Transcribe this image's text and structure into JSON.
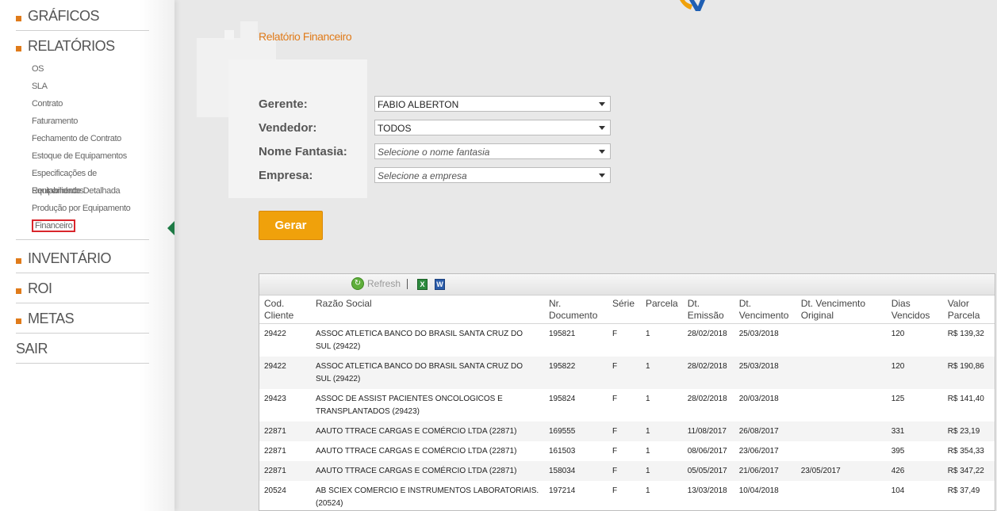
{
  "sidebar": {
    "graficos": "GRÁFICOS",
    "relatorios": "RELATÓRIOS",
    "relatorios_items": [
      "OS",
      "SLA",
      "Contrato",
      "Faturamento",
      "Fechamento de Contrato",
      "Estoque de Equipamentos",
      "Especificações de Equipamentos",
      "Rentabilidade Detalhada",
      "Produção por Equipamento",
      "Financeiro"
    ],
    "active_item": "Financeiro",
    "inventario": "INVENTÁRIO",
    "roi": "ROI",
    "metas": "METAS",
    "sair": "SAIR"
  },
  "page": {
    "title": "Relatório Financeiro"
  },
  "form": {
    "gerente_label": "Gerente:",
    "gerente_value": "FABIO ALBERTON",
    "vendedor_label": "Vendedor:",
    "vendedor_value": "TODOS",
    "fantasia_label": "Nome Fantasia:",
    "fantasia_placeholder": "Selecione o nome fantasia",
    "empresa_label": "Empresa:",
    "empresa_placeholder": "Selecione a empresa",
    "gerar_label": "Gerar"
  },
  "grid": {
    "toolbar": {
      "refresh_label": "Refresh",
      "excel_icon": "excel-export-icon",
      "word_icon": "word-export-icon"
    },
    "headers": {
      "cod": [
        "Cod.",
        "Cliente"
      ],
      "razao": [
        "Razão Social",
        ""
      ],
      "nr": [
        "Nr.",
        "Documento"
      ],
      "serie": [
        "Série",
        ""
      ],
      "parcela": [
        "Parcela",
        ""
      ],
      "emissao": [
        "Dt.",
        "Emissão"
      ],
      "vencimento": [
        "Dt.",
        "Vencimento"
      ],
      "original": [
        "Dt. Vencimento",
        "Original"
      ],
      "dias": [
        "Dias",
        "Vencidos"
      ],
      "valor": [
        "Valor",
        "Parcela"
      ]
    },
    "rows": [
      {
        "cod": "29422",
        "razao": "ASSOC ATLETICA BANCO DO BRASIL SANTA CRUZ DO SUL (29422)",
        "nr": "195821",
        "serie": "F",
        "parcela": "1",
        "emissao": "28/02/2018",
        "vencimento": "25/03/2018",
        "original": "",
        "dias": "120",
        "valor": "R$ 139,32"
      },
      {
        "cod": "29422",
        "razao": "ASSOC ATLETICA BANCO DO BRASIL SANTA CRUZ DO SUL (29422)",
        "nr": "195822",
        "serie": "F",
        "parcela": "1",
        "emissao": "28/02/2018",
        "vencimento": "25/03/2018",
        "original": "",
        "dias": "120",
        "valor": "R$ 190,86"
      },
      {
        "cod": "29423",
        "razao": "ASSOC DE ASSIST PACIENTES ONCOLOGICOS E TRANSPLANTADOS (29423)",
        "nr": "195824",
        "serie": "F",
        "parcela": "1",
        "emissao": "28/02/2018",
        "vencimento": "20/03/2018",
        "original": "",
        "dias": "125",
        "valor": "R$ 141,40"
      },
      {
        "cod": "22871",
        "razao": "AAUTO TTRACE CARGAS E COMÉRCIO LTDA (22871)",
        "nr": "169555",
        "serie": "F",
        "parcela": "1",
        "emissao": "11/08/2017",
        "vencimento": "26/08/2017",
        "original": "",
        "dias": "331",
        "valor": "R$ 23,19"
      },
      {
        "cod": "22871",
        "razao": "AAUTO TTRACE CARGAS E COMÉRCIO LTDA (22871)",
        "nr": "161503",
        "serie": "F",
        "parcela": "1",
        "emissao": "08/06/2017",
        "vencimento": "23/06/2017",
        "original": "",
        "dias": "395",
        "valor": "R$ 354,33"
      },
      {
        "cod": "22871",
        "razao": "AAUTO TTRACE CARGAS E COMÉRCIO LTDA (22871)",
        "nr": "158034",
        "serie": "F",
        "parcela": "1",
        "emissao": "05/05/2017",
        "vencimento": "21/06/2017",
        "original": "23/05/2017",
        "dias": "426",
        "valor": "R$ 347,22"
      },
      {
        "cod": "20524",
        "razao": "AB SCIEX COMERCIO E INSTRUMENTOS LABORATORIAIS. (20524)",
        "nr": "197214",
        "serie": "F",
        "parcela": "1",
        "emissao": "13/03/2018",
        "vencimento": "10/04/2018",
        "original": "",
        "dias": "104",
        "valor": "R$ 37,49"
      }
    ]
  },
  "colors": {
    "accent_orange": "#e07b1a",
    "button": "#f0a10b",
    "active_border": "#d9262c",
    "arrow": "#1d7a45"
  }
}
